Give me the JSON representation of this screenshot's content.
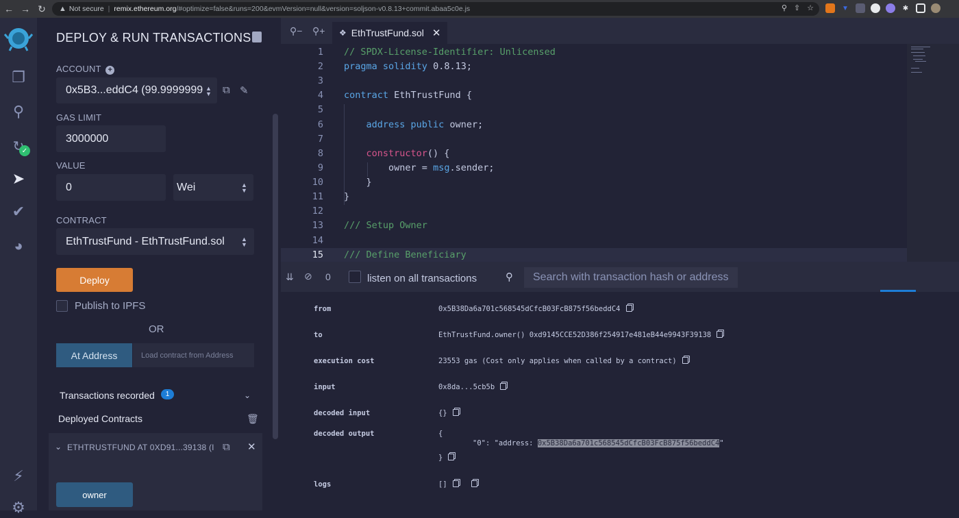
{
  "browser": {
    "security": "Not secure",
    "host": "remix.ethereum.org",
    "path": "/#optimize=false&runs=200&evmVersion=null&version=soljson-v0.8.13+commit.abaa5c0e.js"
  },
  "panel": {
    "title": "DEPLOY & RUN TRANSACTIONS",
    "account_label": "ACCOUNT",
    "account_value": "0x5B3...eddC4 (99.9999999",
    "gas_limit_label": "GAS LIMIT",
    "gas_limit_value": "3000000",
    "value_label": "VALUE",
    "value_amount": "0",
    "value_unit": "Wei",
    "contract_label": "CONTRACT",
    "contract_value": "EthTrustFund - EthTrustFund.sol",
    "deploy_label": "Deploy",
    "publish_label": "Publish to IPFS",
    "or_label": "OR",
    "at_address_label": "At Address",
    "load_address_placeholder": "Load contract from Address",
    "tx_recorded_label": "Transactions recorded",
    "tx_recorded_count": "1",
    "deployed_label": "Deployed Contracts",
    "instance_title": "ETHTRUSTFUND AT 0XD91...39138 (I",
    "owner_button": "owner"
  },
  "editor": {
    "tab_name": "EthTrustFund.sol",
    "lines": [
      "1",
      "2",
      "3",
      "4",
      "5",
      "6",
      "7",
      "8",
      "9",
      "10",
      "11",
      "12",
      "13",
      "14",
      "15"
    ]
  },
  "terminal": {
    "pending_count": "0",
    "listen_label": "listen on all transactions",
    "search_placeholder": "Search with transaction hash or address",
    "rows": {
      "from_key": "from",
      "from_val": "0x5B38Da6a701c568545dCfcB03FcB875f56beddC4",
      "to_key": "to",
      "to_val": "EthTrustFund.owner() 0xd9145CCE52D386f254917e481eB44e9943F39138",
      "exec_key": "execution cost",
      "exec_val": "23553 gas (Cost only applies when called by a contract)",
      "input_key": "input",
      "input_val": "0x8da...5cb5b",
      "decin_key": "decoded input",
      "decin_val": "{}",
      "decout_key": "decoded output",
      "decout_open": "{",
      "decout_prefix": "\"0\": \"address: ",
      "decout_addr": "0x5B38Da6a701c568545dCfcB03FcB875f56beddC4",
      "decout_suffix": "\"",
      "decout_close": "}",
      "logs_key": "logs",
      "logs_val": "[]"
    }
  }
}
